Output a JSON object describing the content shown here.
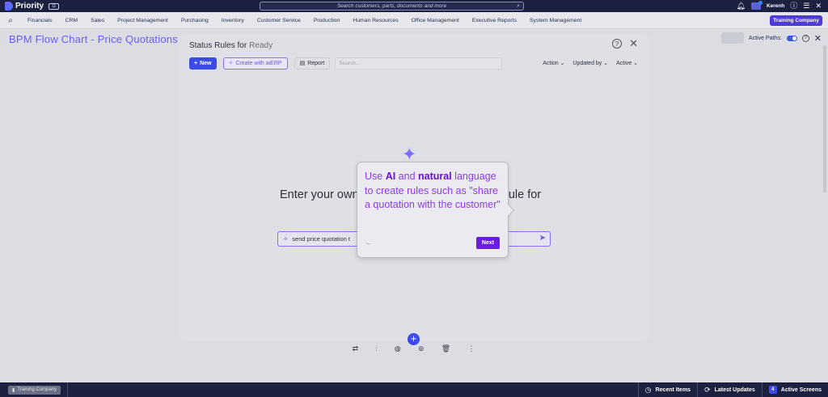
{
  "topbar": {
    "app_name": "Priority",
    "search_placeholder": "Search customers, parts, documents and more",
    "user_name": "Kerenh"
  },
  "nav": {
    "items": [
      "Financials",
      "CRM",
      "Sales",
      "Project Management",
      "Purchasing",
      "Inventory",
      "Customer Service",
      "Production",
      "Human Resources",
      "Office Management",
      "Executive Reports",
      "System Management"
    ],
    "company_button": "Training Company"
  },
  "page": {
    "title": "BPM Flow Chart - Price Quotations fo",
    "active_paths_label": "Active Paths:"
  },
  "panel": {
    "title": "Status Rules for",
    "status": "Ready",
    "new_label": "New",
    "ai_label": "Create with aiERP",
    "report_label": "Report",
    "search_placeholder": "Search...",
    "filters": [
      "Action",
      "Updated by",
      "Active"
    ],
    "prompt_heading": "Enter your own",
    "prompt_heading_tail": "rule for",
    "prompt_value": "send price quotation t"
  },
  "tooltip": {
    "text_parts": [
      "Use ",
      "AI",
      " and ",
      "natural",
      " language to create rules such as \"share a quotation with the customer\""
    ],
    "back_label": "←",
    "next_label": "Next"
  },
  "bottombar": {
    "company": "Training Company",
    "recent": "Recent Items",
    "updates": "Latest Updates",
    "active": "Active Screens",
    "active_count": "4"
  }
}
